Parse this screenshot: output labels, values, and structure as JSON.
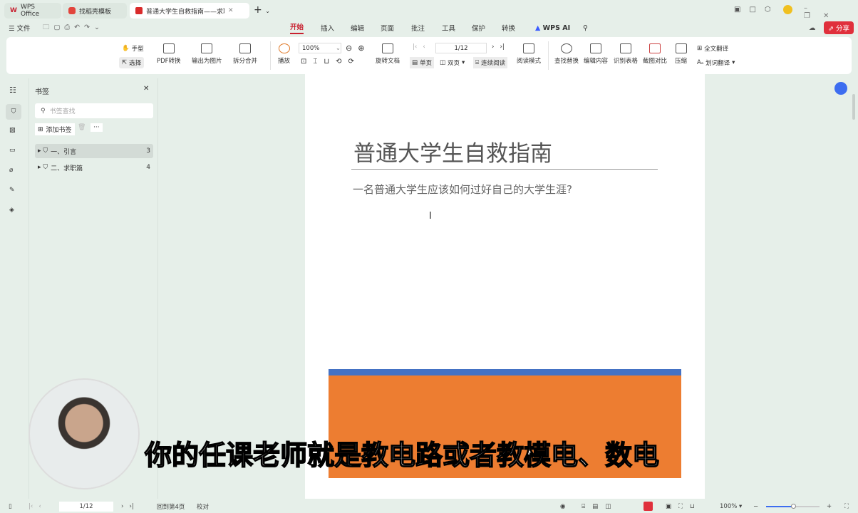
{
  "tabs": [
    {
      "label": "WPS Office"
    },
    {
      "label": "找稻壳模板"
    },
    {
      "label": "普通大学生自救指南——求职"
    }
  ],
  "menu": {
    "file": "文件",
    "items": [
      "开始",
      "插入",
      "编辑",
      "页面",
      "批注",
      "工具",
      "保护",
      "转换"
    ],
    "ai": "WPS AI",
    "share": "分享"
  },
  "ribbon": {
    "hand": "手型",
    "select": "选择",
    "pdf_convert": "PDF转换",
    "export_image": "输出为图片",
    "split_merge": "拆分合并",
    "play": "播放",
    "zoom": "100%",
    "rotate": "旋转文档",
    "page": "1/12",
    "single": "单页",
    "double": "双页",
    "continuous": "连续阅读",
    "read_mode": "阅读模式",
    "find_replace": "查找替换",
    "edit_content": "编辑内容",
    "recognize_table": "识别表格",
    "screenshot_compare": "截图对比",
    "compress": "压缩",
    "full_translate": "全文翻译",
    "word_translate": "划词翻译"
  },
  "panel": {
    "title": "书签",
    "search_placeholder": "书签查找",
    "add": "添加书签",
    "items": [
      {
        "label": "一、引言",
        "page": "3"
      },
      {
        "label": "二、求职篇",
        "page": "4"
      }
    ]
  },
  "doc": {
    "title": "普通大学生自救指南",
    "subtitle": "一名普通大学生应该如何过好自己的大学生涯?"
  },
  "overlay": {
    "caption": "你的任课老师就是教电路或者教模电、数电"
  },
  "status": {
    "page": "1/12",
    "back": "回到第4页",
    "proof": "校对",
    "zoom": "100%"
  },
  "colors": {
    "accent": "#c8202f",
    "orange": "#ed7d31",
    "blue": "#4472c4"
  }
}
